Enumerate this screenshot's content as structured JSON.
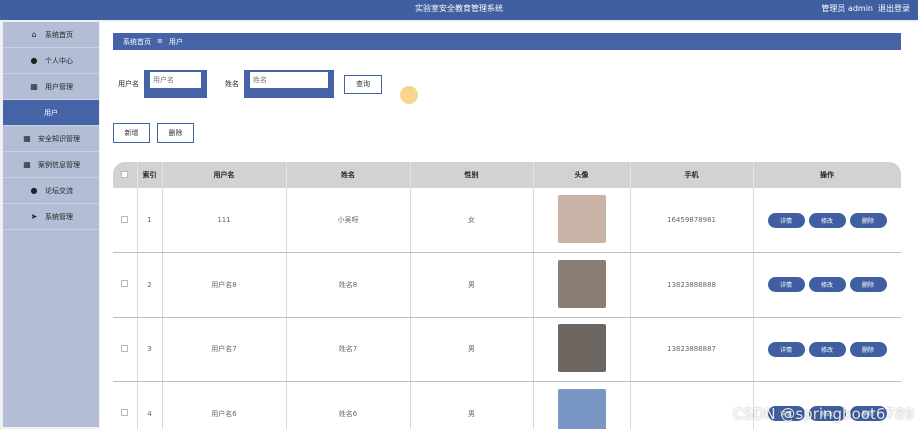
{
  "header": {
    "title": "实验室安全教育管理系统",
    "user_label": "管理员 admin",
    "logout": "退出登录"
  },
  "sidebar": {
    "items": [
      {
        "label": "系统首页",
        "icon": "home-icon",
        "glyph": "⌂"
      },
      {
        "label": "个人中心",
        "icon": "person-icon",
        "glyph": "●"
      },
      {
        "label": "用户管理",
        "icon": "grid-icon",
        "glyph": "▦"
      },
      {
        "label": "用户",
        "icon": "",
        "glyph": "",
        "active": true
      },
      {
        "label": "安全知识管理",
        "icon": "grid-icon",
        "glyph": "▦"
      },
      {
        "label": "案例信息管理",
        "icon": "grid-icon",
        "glyph": "▦"
      },
      {
        "label": "论坛交流",
        "icon": "person-icon",
        "glyph": "●"
      },
      {
        "label": "系统管理",
        "icon": "send-icon",
        "glyph": "➤"
      }
    ]
  },
  "breadcrumb": {
    "home": "系统首页",
    "sep": "≡",
    "current": "用户"
  },
  "search": {
    "username_label": "用户名",
    "username_placeholder": "用户名",
    "name_label": "姓名",
    "name_placeholder": "姓名",
    "query_button": "查询"
  },
  "actions": {
    "add": "新增",
    "delete": "删除"
  },
  "table": {
    "headers": [
      "",
      "索引",
      "用户名",
      "姓名",
      "性别",
      "头像",
      "手机",
      "操作"
    ],
    "rows": [
      {
        "index": "1",
        "username": "111",
        "name": "小吴呀",
        "gender": "女",
        "phone": "16459878981",
        "avatar_color": "#c9b2a6"
      },
      {
        "index": "2",
        "username": "用户名8",
        "name": "姓名8",
        "gender": "男",
        "phone": "13823888888",
        "avatar_color": "#8a7d74"
      },
      {
        "index": "3",
        "username": "用户名7",
        "name": "姓名7",
        "gender": "男",
        "phone": "13823888887",
        "avatar_color": "#6e6660"
      },
      {
        "index": "4",
        "username": "用户名6",
        "name": "姓名6",
        "gender": "男",
        "phone": "",
        "avatar_color": "#7a96c4"
      }
    ],
    "op_detail": "详情",
    "op_edit": "修改",
    "op_delete": "删除"
  },
  "watermark": "CSDN @springboot6789",
  "colors": {
    "primary": "#4663a8",
    "sidebar": "#b3bdd6",
    "header": "#3f5fa0"
  }
}
